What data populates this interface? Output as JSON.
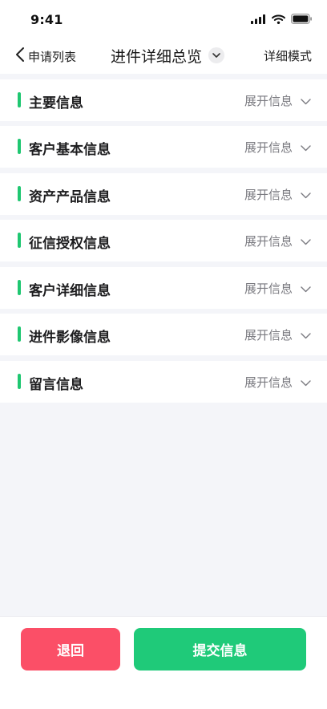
{
  "status_bar": {
    "time": "9:41",
    "icons": [
      "signal-icon",
      "wifi-icon",
      "battery-icon"
    ]
  },
  "nav": {
    "back_label": "申请列表",
    "title": "进件详细总览",
    "right_label": "详细模式",
    "icons": {
      "back": "chevron-left-icon",
      "title_toggle": "chevron-down-icon"
    }
  },
  "sections": [
    {
      "title": "主要信息",
      "expand_label": "展开信息"
    },
    {
      "title": "客户基本信息",
      "expand_label": "展开信息"
    },
    {
      "title": "资产产品信息",
      "expand_label": "展开信息"
    },
    {
      "title": "征信授权信息",
      "expand_label": "展开信息"
    },
    {
      "title": "客户详细信息",
      "expand_label": "展开信息"
    },
    {
      "title": "进件影像信息",
      "expand_label": "展开信息"
    },
    {
      "title": "留言信息",
      "expand_label": "展开信息"
    }
  ],
  "footer": {
    "back_button_label": "退回",
    "submit_button_label": "提交信息"
  },
  "colors": {
    "accent_green": "#1fc771",
    "submit_green": "#1fca79",
    "back_red": "#fb4f67",
    "page_background": "#f4f5f9"
  }
}
